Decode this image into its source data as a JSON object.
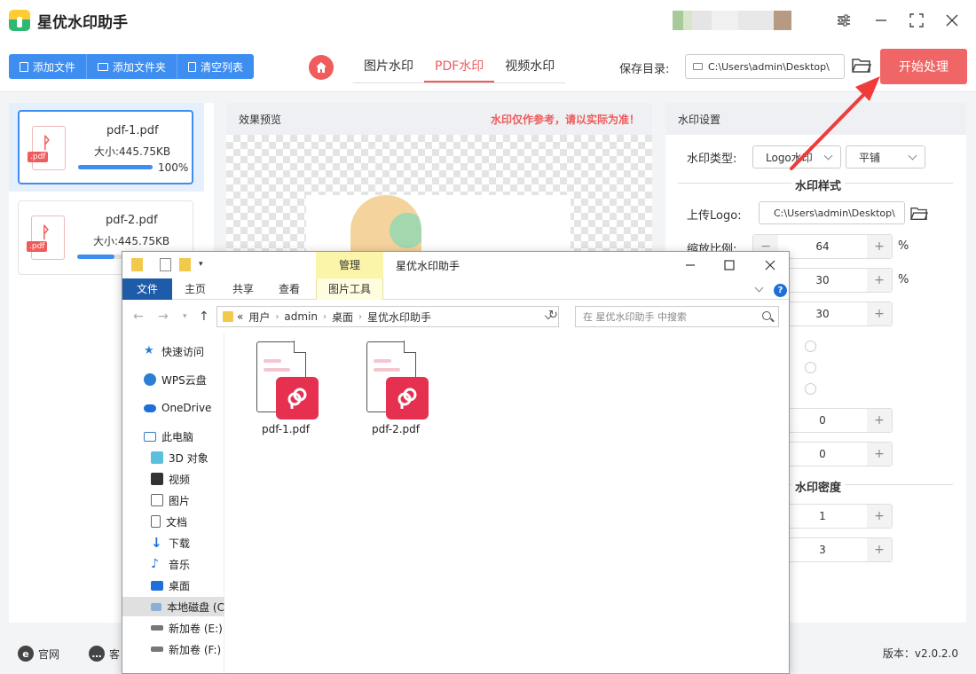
{
  "app": {
    "title": "星优水印助手"
  },
  "toolbar": {
    "add_file": "添加文件",
    "add_folder": "添加文件夹",
    "clear_list": "清空列表",
    "tabs": [
      "图片水印",
      "PDF水印",
      "视频水印"
    ],
    "active_tab": "PDF水印",
    "save_label": "保存目录:",
    "save_path": "C:\\Users\\admin\\Desktop\\",
    "start": "开始处理"
  },
  "files": [
    {
      "name": "pdf-1.pdf",
      "size": "大小:445.75KB",
      "progress": 100,
      "progress_label": "100%"
    },
    {
      "name": "pdf-2.pdf",
      "size": "大小:445.75KB",
      "progress": 50
    }
  ],
  "preview": {
    "title": "效果预览",
    "warning": "水印仅作参考，请以实际为准！"
  },
  "settings": {
    "title": "水印设置",
    "type_label": "水印类型:",
    "type_value": "Logo水印",
    "layout_value": "平铺",
    "style_section": "水印样式",
    "upload_label": "上传Logo:",
    "upload_path": "C:\\Users\\admin\\Desktop\\",
    "scale_label": "缩放比例:",
    "scale_value": "64",
    "unit": "%",
    "v2": "30",
    "v3": "30",
    "v4": "0",
    "v5": "0",
    "density_section": "水印密度",
    "v6": "1",
    "v7": "3",
    "minus": "−",
    "plus": "+"
  },
  "footer": {
    "website": "官网",
    "service": "客",
    "version": "版本：v2.0.2.0"
  },
  "explorer": {
    "title": "星优水印助手",
    "manage": "管理",
    "ribbon": {
      "file": "文件",
      "home": "主页",
      "share": "共享",
      "view": "查看",
      "picture_tools": "图片工具"
    },
    "breadcrumb": {
      "prefix": "«",
      "items": [
        "用户",
        "admin",
        "桌面",
        "星优水印助手"
      ],
      "sep": "›"
    },
    "search_placeholder": "在 星优水印助手 中搜索",
    "nav": {
      "quick": "快速访问",
      "wps": "WPS云盘",
      "onedrive": "OneDrive",
      "pc": "此电脑",
      "obj3d": "3D 对象",
      "video": "视频",
      "pictures": "图片",
      "docs": "文档",
      "downloads": "下载",
      "music": "音乐",
      "desktop": "桌面",
      "local": "本地磁盘 (C",
      "vol_e": "新加卷 (E:)",
      "vol_f": "新加卷 (F:)"
    },
    "files": [
      "pdf-1.pdf",
      "pdf-2.pdf"
    ]
  }
}
